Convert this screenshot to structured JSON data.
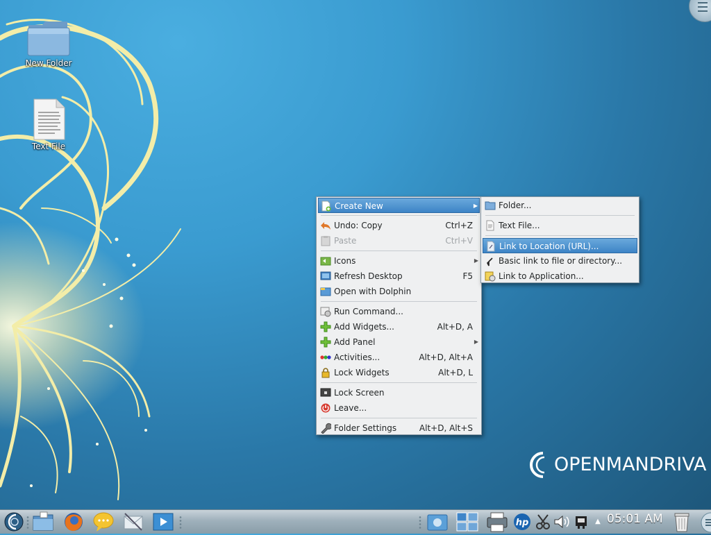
{
  "desktop": {
    "icons": [
      {
        "label": "New Folder",
        "icon": "folder-icon"
      },
      {
        "label": "Text File",
        "icon": "text-file-icon"
      }
    ],
    "logo_text": "OPENMANDRIVA"
  },
  "context_menu": {
    "items": [
      {
        "label": "Create New",
        "shortcut": "",
        "icon": "create-new-icon",
        "has_submenu": true,
        "highlighted": true
      },
      {
        "label": "Undo: Copy",
        "shortcut": "Ctrl+Z",
        "icon": "undo-icon"
      },
      {
        "label": "Paste",
        "shortcut": "Ctrl+V",
        "icon": "paste-icon",
        "disabled": true
      },
      {
        "label": "Icons",
        "shortcut": "",
        "icon": "icons-icon",
        "has_submenu": true
      },
      {
        "label": "Refresh Desktop",
        "shortcut": "F5",
        "icon": "refresh-desktop-icon"
      },
      {
        "label": "Open with Dolphin",
        "shortcut": "",
        "icon": "dolphin-icon"
      },
      {
        "label": "Run Command...",
        "shortcut": "",
        "icon": "run-command-icon"
      },
      {
        "label": "Add Widgets...",
        "shortcut": "Alt+D, A",
        "icon": "add-widgets-icon"
      },
      {
        "label": "Add Panel",
        "shortcut": "",
        "icon": "add-panel-icon",
        "has_submenu": true
      },
      {
        "label": "Activities...",
        "shortcut": "Alt+D, Alt+A",
        "icon": "activities-icon"
      },
      {
        "label": "Lock Widgets",
        "shortcut": "Alt+D, L",
        "icon": "lock-widgets-icon"
      },
      {
        "label": "Lock Screen",
        "shortcut": "",
        "icon": "lock-screen-icon"
      },
      {
        "label": "Leave...",
        "shortcut": "",
        "icon": "leave-icon"
      },
      {
        "label": "Folder Settings",
        "shortcut": "Alt+D, Alt+S",
        "icon": "folder-settings-icon"
      }
    ]
  },
  "submenu": {
    "items": [
      {
        "label": "Folder...",
        "icon": "folder-icon"
      },
      {
        "label": "Text File...",
        "icon": "text-file-icon"
      },
      {
        "label": "Link to Location (URL)...",
        "icon": "link-url-icon",
        "highlighted": true
      },
      {
        "label": "Basic link to file or directory...",
        "icon": "link-icon"
      },
      {
        "label": "Link to Application...",
        "icon": "link-application-icon"
      }
    ]
  },
  "taskbar": {
    "launchers": [
      "application-launcher-icon",
      "file-manager-icon",
      "firefox-icon",
      "chat-icon",
      "mail-icon",
      "media-player-icon"
    ],
    "tray": [
      "device-notifier-icon",
      "pager-icon",
      "printer-icon",
      "hp-icon",
      "clipboard-icon",
      "volume-icon",
      "network-icon",
      "tray-expand-icon",
      "trash-icon"
    ],
    "clock": "05:01 AM"
  }
}
